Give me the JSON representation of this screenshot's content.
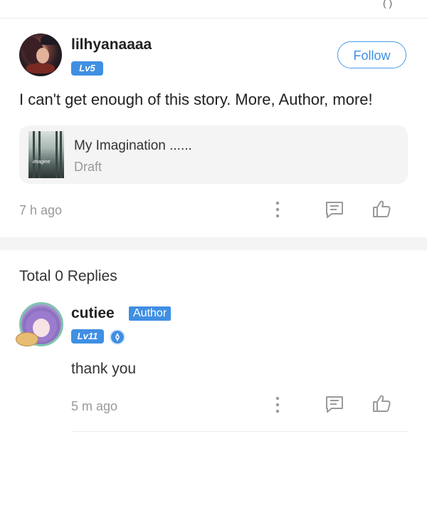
{
  "header": {
    "top_cut_text": "( )"
  },
  "comment": {
    "username": "lilhyanaaaa",
    "level": "Lv5",
    "follow_label": "Follow",
    "text": "I can't get enough of this story. More, Author, more!",
    "story": {
      "title": "My Imagination ......",
      "status": "Draft",
      "cover_text": "imagine"
    },
    "time": "7 h ago",
    "icons": [
      "more-vertical-icon",
      "comment-icon",
      "thumbs-up-icon"
    ]
  },
  "replies": {
    "total_label": "Total 0 Replies",
    "items": [
      {
        "username": "cutiee",
        "author_badge": "Author",
        "level": "Lv11",
        "text": "thank you",
        "time": "5 m ago"
      }
    ]
  },
  "colors": {
    "accent": "#3f8fe3",
    "muted_text": "#999999",
    "card_bg": "#f4f4f4"
  }
}
